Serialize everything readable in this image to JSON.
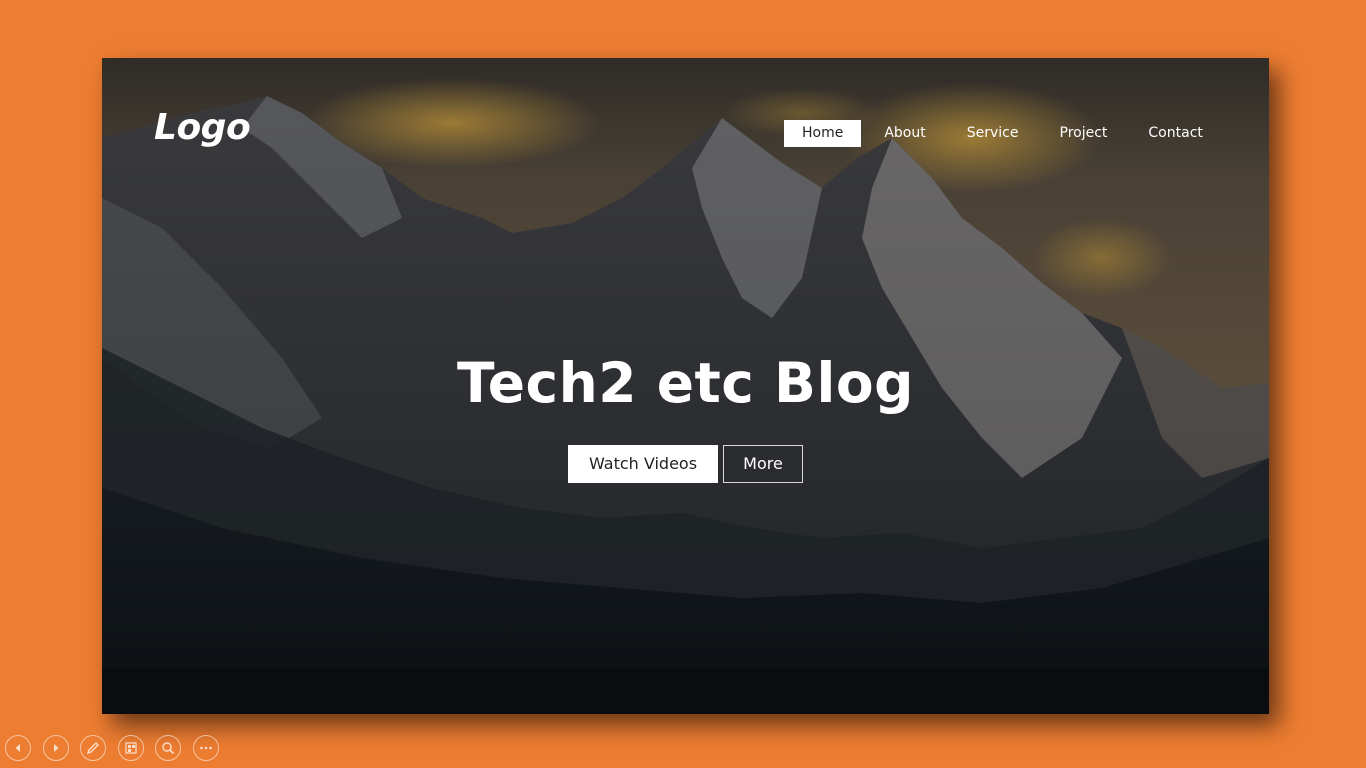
{
  "site": {
    "logo": "Logo"
  },
  "nav": {
    "items": [
      {
        "label": "Home",
        "active": true
      },
      {
        "label": "About",
        "active": false
      },
      {
        "label": "Service",
        "active": false
      },
      {
        "label": "Project",
        "active": false
      },
      {
        "label": "Contact",
        "active": false
      }
    ]
  },
  "hero": {
    "title": "Tech2 etc Blog",
    "primary_button": "Watch Videos",
    "secondary_button": "More"
  },
  "toolbar": {
    "icons": [
      "previous-slide-icon",
      "next-slide-icon",
      "pen-icon",
      "slide-sorter-icon",
      "zoom-icon",
      "more-options-icon"
    ]
  },
  "colors": {
    "page_background": "#ed7d31",
    "accent_white": "#ffffff",
    "nav_active_text": "#222222"
  }
}
